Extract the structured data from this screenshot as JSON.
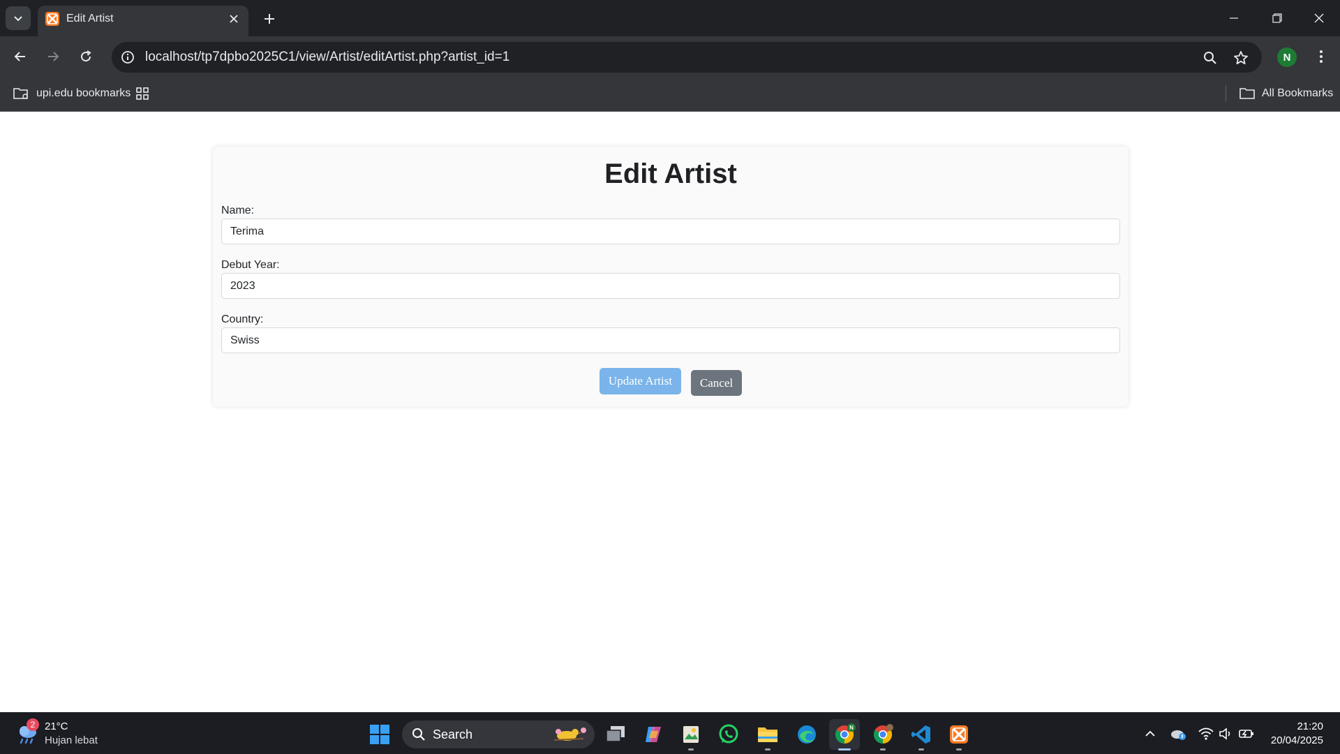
{
  "browser": {
    "tab": {
      "title": "Edit Artist",
      "favicon": "xampp-icon"
    },
    "url": "localhost/tp7dpbo2025C1/view/Artist/editArtist.php?artist_id=1",
    "profile_initial": "N",
    "bookmarks": {
      "left_folder": "upi.edu bookmarks",
      "right_folder": "All Bookmarks"
    }
  },
  "page": {
    "title": "Edit Artist",
    "form": {
      "name": {
        "label": "Name:",
        "value": "Terima"
      },
      "debut_year": {
        "label": "Debut Year:",
        "value": "2023"
      },
      "country": {
        "label": "Country:",
        "value": "Swiss"
      },
      "update_label": "Update Artist",
      "cancel_label": "Cancel"
    }
  },
  "taskbar": {
    "weather": {
      "temp": "21°C",
      "desc": "Hujan lebat",
      "badge": "2"
    },
    "search_label": "Search",
    "clock": {
      "time": "21:20",
      "date": "20/04/2025"
    },
    "apps": [
      "windows-start",
      "task-view",
      "copilot",
      "gallery",
      "whatsapp",
      "file-explorer",
      "edge",
      "chrome-profile-n",
      "chrome",
      "vscode",
      "xampp"
    ]
  },
  "colors": {
    "accent_update": "#7ab4ea",
    "cancel": "#6c757d",
    "chrome_dark": "#202124",
    "chrome_toolbar": "#35363a",
    "xampp_orange": "#fb7a24"
  }
}
